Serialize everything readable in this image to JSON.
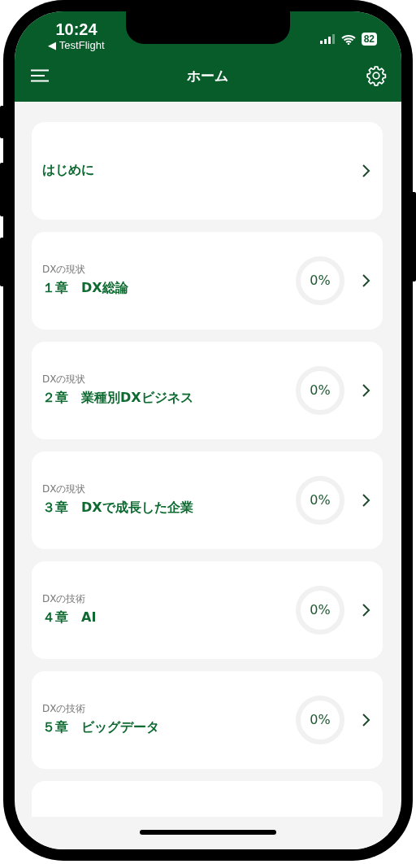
{
  "status_bar": {
    "time": "10:24",
    "back_label": "◀ TestFlight",
    "battery": "82"
  },
  "header": {
    "title": "ホーム"
  },
  "cards": [
    {
      "kind": "intro",
      "title": "はじめに"
    },
    {
      "kind": "chapter",
      "category": "DXの現状",
      "title": "１章　DX総論",
      "progress": {
        "level": 0,
        "label": "0%"
      }
    },
    {
      "kind": "chapter",
      "category": "DXの現状",
      "title": "２章　業種別DXビジネス",
      "progress": {
        "level": 0,
        "label": "0%"
      }
    },
    {
      "kind": "chapter",
      "category": "DXの現状",
      "title": "３章　DXで成長した企業",
      "progress": {
        "level": 0,
        "label": "0%"
      }
    },
    {
      "kind": "chapter",
      "category": "DXの技術",
      "title": "４章　AI",
      "progress": {
        "level": 0,
        "label": "0%"
      }
    },
    {
      "kind": "chapter",
      "category": "DXの技術",
      "title": "５章　ビッグデータ",
      "progress": {
        "level": 0,
        "label": "0%"
      }
    }
  ]
}
